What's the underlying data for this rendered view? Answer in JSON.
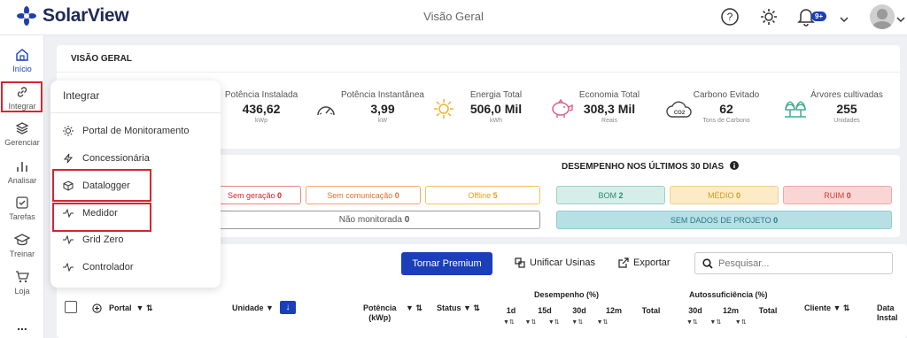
{
  "header": {
    "app_name": "SolarView",
    "page_title": "Visão Geral",
    "notification_badge": "9+",
    "icons": [
      "help-icon",
      "gear-icon",
      "bell-icon",
      "chevron-down-icon"
    ]
  },
  "sidebar": {
    "items": [
      {
        "label": "Início",
        "icon": "home-icon"
      },
      {
        "label": "Integrar",
        "icon": "link-icon"
      },
      {
        "label": "Gerenciar",
        "icon": "layers-icon"
      },
      {
        "label": "Analisar",
        "icon": "bar-chart-icon"
      },
      {
        "label": "Tarefas",
        "icon": "checkbox-icon"
      },
      {
        "label": "Treinar",
        "icon": "graduation-cap-icon"
      },
      {
        "label": "Loja",
        "icon": "cart-icon"
      }
    ],
    "more": "..."
  },
  "overview": {
    "title": "VISÃO GERAL",
    "metrics": [
      {
        "label": "Potência Instalada",
        "value": "436,62",
        "unit": "kWp"
      },
      {
        "label": "Potência Instantânea",
        "value": "3,99",
        "unit": "kW"
      },
      {
        "label": "Energia Total",
        "value": "506,0 Mil",
        "unit": "kWh"
      },
      {
        "label": "Economia Total",
        "value": "308,3 Mil",
        "unit": "Reais"
      },
      {
        "label": "Carbono Evitado",
        "value": "62",
        "unit": "Tons de Carbono"
      },
      {
        "label": "Árvores cultivadas",
        "value": "255",
        "unit": "Unidades"
      }
    ],
    "co2_label": "CO2"
  },
  "status": {
    "chips": [
      {
        "text": "Sem geração ",
        "count": "0"
      },
      {
        "text": "Sem comunicação ",
        "count": "0"
      },
      {
        "text": "Offline ",
        "count": "5"
      },
      {
        "text": "Não monitorada ",
        "count": "0"
      }
    ]
  },
  "performance": {
    "title": "DESEMPENHO NOS ÚLTIMOS 30 DIAS",
    "chips": [
      {
        "text": "BOM ",
        "count": "2"
      },
      {
        "text": "MÉDIO ",
        "count": "0"
      },
      {
        "text": "RUIM ",
        "count": "0"
      },
      {
        "text": "SEM DADOS DE PROJETO ",
        "count": "0"
      }
    ]
  },
  "integrar_menu": {
    "title": "Integrar",
    "items": [
      {
        "label": "Portal de Monitoramento",
        "icon": "sun-icon"
      },
      {
        "label": "Concessionária",
        "icon": "bolt-icon"
      },
      {
        "label": "Datalogger",
        "icon": "cube-icon"
      },
      {
        "label": "Medidor",
        "icon": "pulse-icon"
      },
      {
        "label": "Grid Zero",
        "icon": "pulse-icon"
      },
      {
        "label": "Controlador",
        "icon": "pulse-icon"
      }
    ]
  },
  "toolbar": {
    "premium_label": "Tornar Premium",
    "unify_label": "Unificar Usinas",
    "export_label": "Exportar",
    "search_placeholder": "Pesquisar..."
  },
  "table": {
    "headers": {
      "portal": "Portal",
      "unidade": "Unidade",
      "potencia": "Potência\n(kWp)",
      "status": "Status",
      "desempenho": "Desempenho (%)",
      "autossuficiencia": "Autossuficiência (%)",
      "cliente": "Cliente",
      "data": "Data\nInstal"
    },
    "desempenho_cols": [
      "1d",
      "15d",
      "30d",
      "12m",
      "Total"
    ],
    "auto_cols": [
      "30d",
      "12m",
      "Total"
    ]
  },
  "colors": {
    "primary": "#1a3fb8",
    "highlight": "#d6262c",
    "bom_bg": "#d6eee8",
    "medio_bg": "#fdebc8",
    "ruim_bg": "#f9d6d4",
    "sem_dados_bg": "#b7dfe4"
  }
}
